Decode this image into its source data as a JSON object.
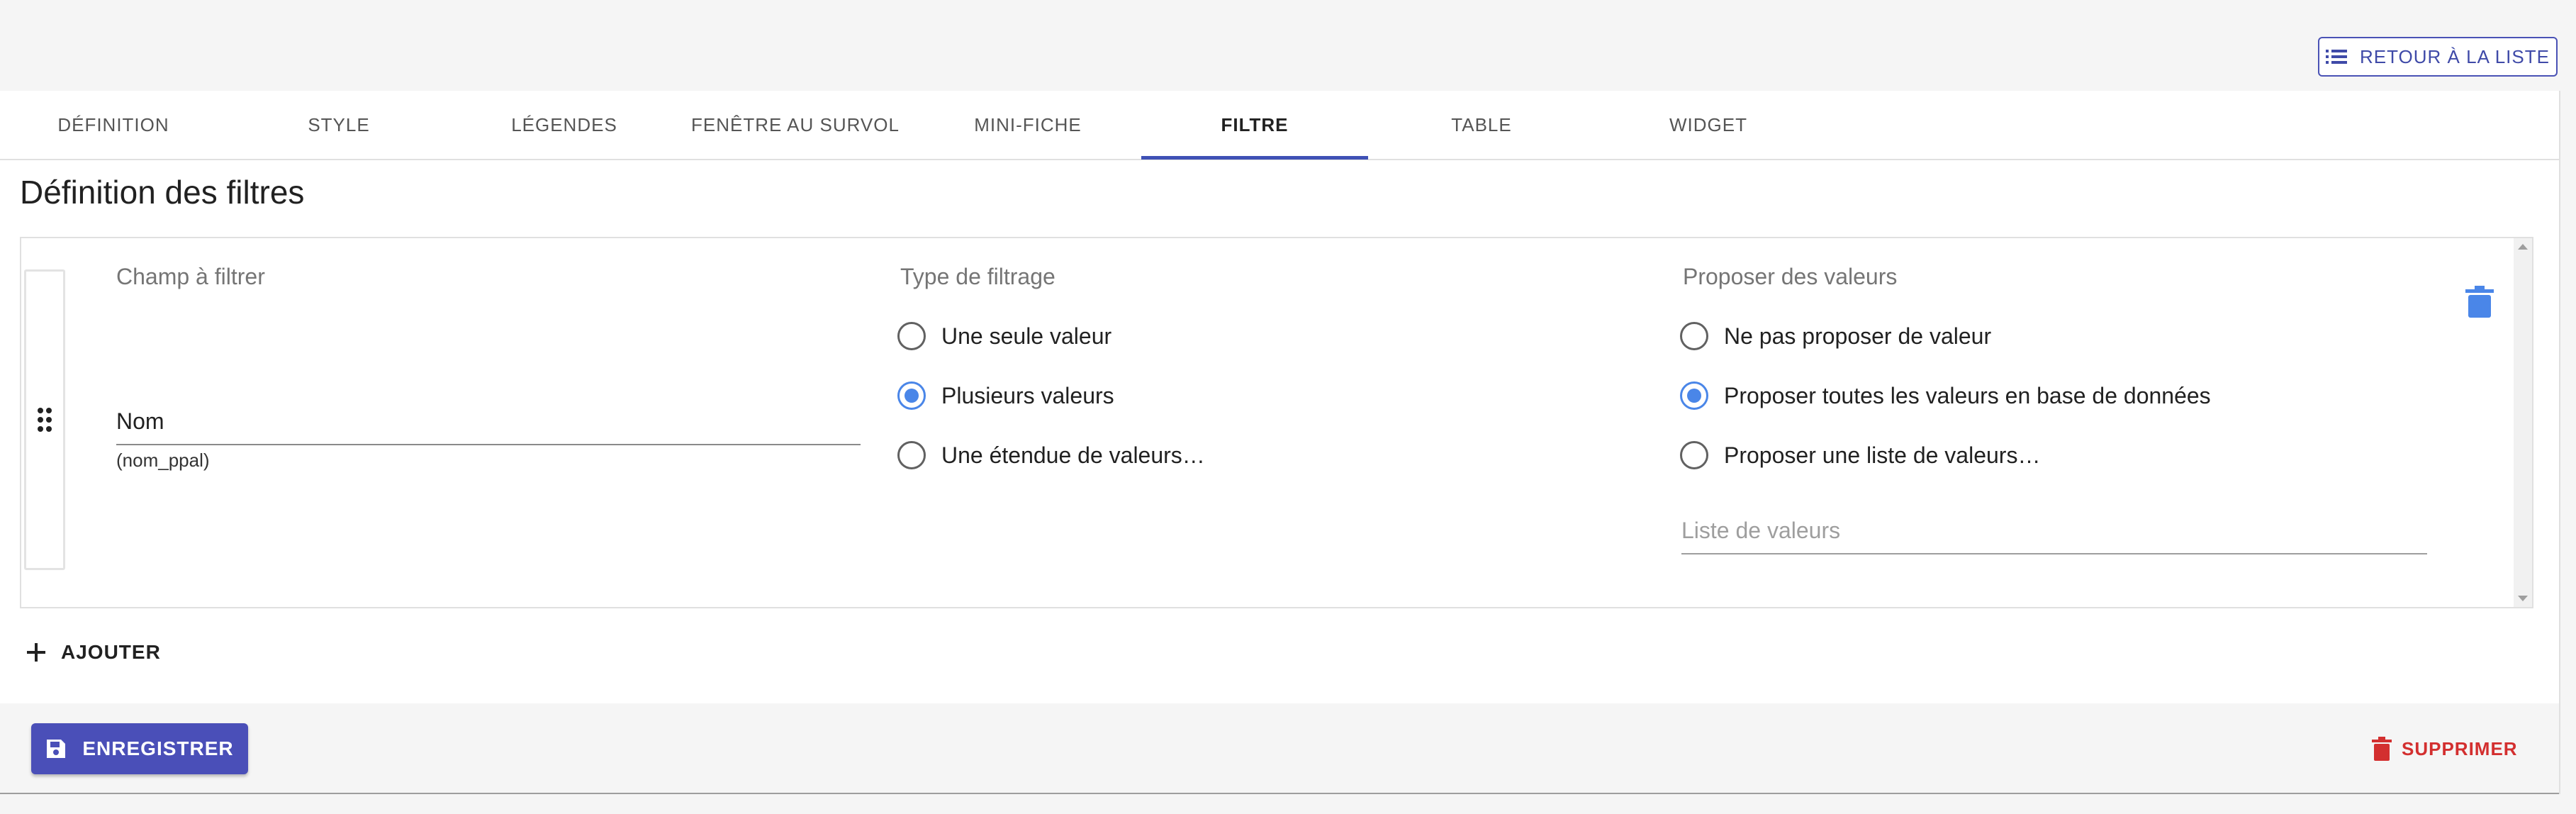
{
  "header": {
    "back_label": "RETOUR À LA LISTE"
  },
  "tabs": [
    {
      "label": "DÉFINITION"
    },
    {
      "label": "STYLE"
    },
    {
      "label": "LÉGENDES"
    },
    {
      "label": "FENÊTRE AU SURVOL"
    },
    {
      "label": "MINI-FICHE"
    },
    {
      "label": "FILTRE"
    },
    {
      "label": "TABLE"
    },
    {
      "label": "WIDGET"
    }
  ],
  "active_tab": "FILTRE",
  "section": {
    "title": "Définition des filtres"
  },
  "filter": {
    "field": {
      "label": "Champ à filtrer",
      "value": "Nom",
      "sub": "(nom_ppal)"
    },
    "type": {
      "label": "Type de filtrage",
      "options": [
        {
          "label": "Une seule valeur",
          "checked": false
        },
        {
          "label": "Plusieurs valeurs",
          "checked": true
        },
        {
          "label": "Une étendue de valeurs…",
          "checked": false
        }
      ]
    },
    "values": {
      "label": "Proposer des valeurs",
      "options": [
        {
          "label": "Ne pas proposer de valeur",
          "checked": false
        },
        {
          "label": "Proposer toutes les valeurs en base de données",
          "checked": true
        },
        {
          "label": "Proposer une liste de valeurs…",
          "checked": false
        }
      ],
      "list_placeholder": "Liste de valeurs"
    }
  },
  "actions": {
    "add_label": "AJOUTER",
    "save_label": "ENREGISTRER",
    "delete_label": "SUPPRIMER"
  },
  "colors": {
    "primary": "#3f51b5",
    "radio_checked": "#4a86e8",
    "danger": "#d32f2f"
  }
}
